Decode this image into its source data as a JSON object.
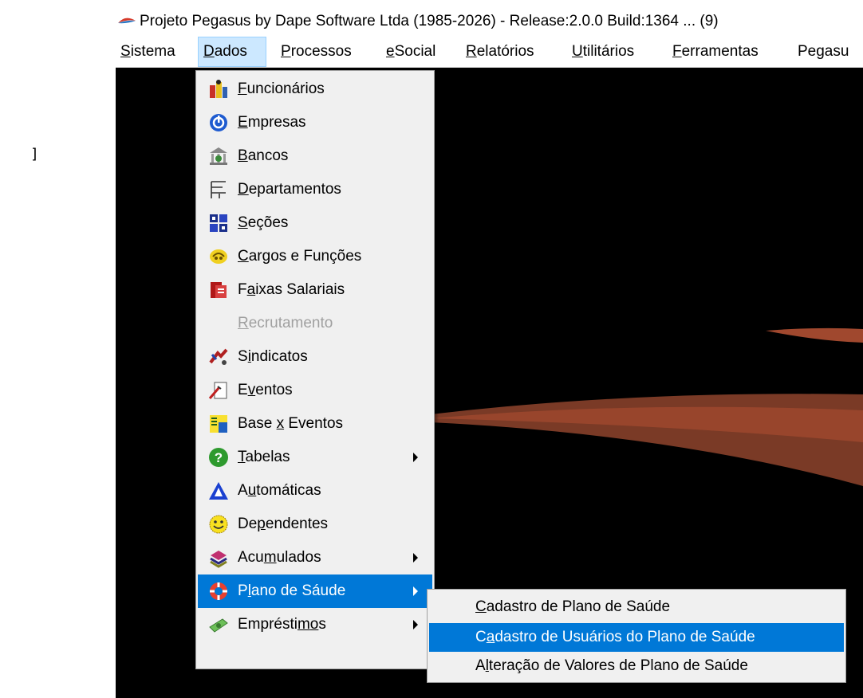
{
  "stray_char": "]",
  "window": {
    "title": "Projeto Pegasus by Dape Software Ltda (1985-2026) - Release:2.0.0  Build:1364 ... (9)"
  },
  "menubar": {
    "items": [
      {
        "label": "Sistema"
      },
      {
        "label": "Dados"
      },
      {
        "label": "Processos"
      },
      {
        "label": "eSocial"
      },
      {
        "label": "Relatórios"
      },
      {
        "label": "Utilitários"
      },
      {
        "label": "Ferramentas"
      },
      {
        "label": "Pegasu"
      }
    ]
  },
  "dados_menu": {
    "items": [
      {
        "label": "Funcionários",
        "icon": "employees-icon"
      },
      {
        "label": "Empresas",
        "icon": "companies-icon"
      },
      {
        "label": "Bancos",
        "icon": "bank-icon"
      },
      {
        "label": "Departamentos",
        "icon": "departments-icon"
      },
      {
        "label": "Seções",
        "icon": "sections-icon"
      },
      {
        "label": "Cargos e Funções",
        "icon": "roles-icon"
      },
      {
        "label": "Faixas Salariais",
        "icon": "salary-ranges-icon"
      },
      {
        "label": "Recrutamento",
        "icon": "",
        "disabled": true
      },
      {
        "label": "Sindicatos",
        "icon": "unions-icon"
      },
      {
        "label": "Eventos",
        "icon": "events-icon"
      },
      {
        "label": "Base x Eventos",
        "icon": "base-events-icon"
      },
      {
        "label": "Tabelas",
        "icon": "help-question-icon",
        "submenu": true
      },
      {
        "label": "Automáticas",
        "icon": "automatic-icon"
      },
      {
        "label": "Dependentes",
        "icon": "smiley-icon"
      },
      {
        "label": "Acumulados",
        "icon": "accumulated-icon",
        "submenu": true
      },
      {
        "label": "Plano de Sáude",
        "icon": "lifebuoy-icon",
        "submenu": true,
        "highlighted": true
      },
      {
        "label": "Empréstimos",
        "icon": "money-icon",
        "submenu": true
      }
    ]
  },
  "plano_submenu": {
    "items": [
      {
        "label": "Cadastro de Plano de Saúde"
      },
      {
        "label": "Cadastro de Usuários do Plano de Saúde",
        "highlighted": true
      },
      {
        "label": "Alteração de Valores de Plano de Saúde"
      }
    ]
  },
  "colors": {
    "highlight": "#0078d7",
    "menu_bg": "#f0f0f0",
    "desktop_bg": "#000000",
    "wallpaper_swoosh": "#a0482e"
  }
}
